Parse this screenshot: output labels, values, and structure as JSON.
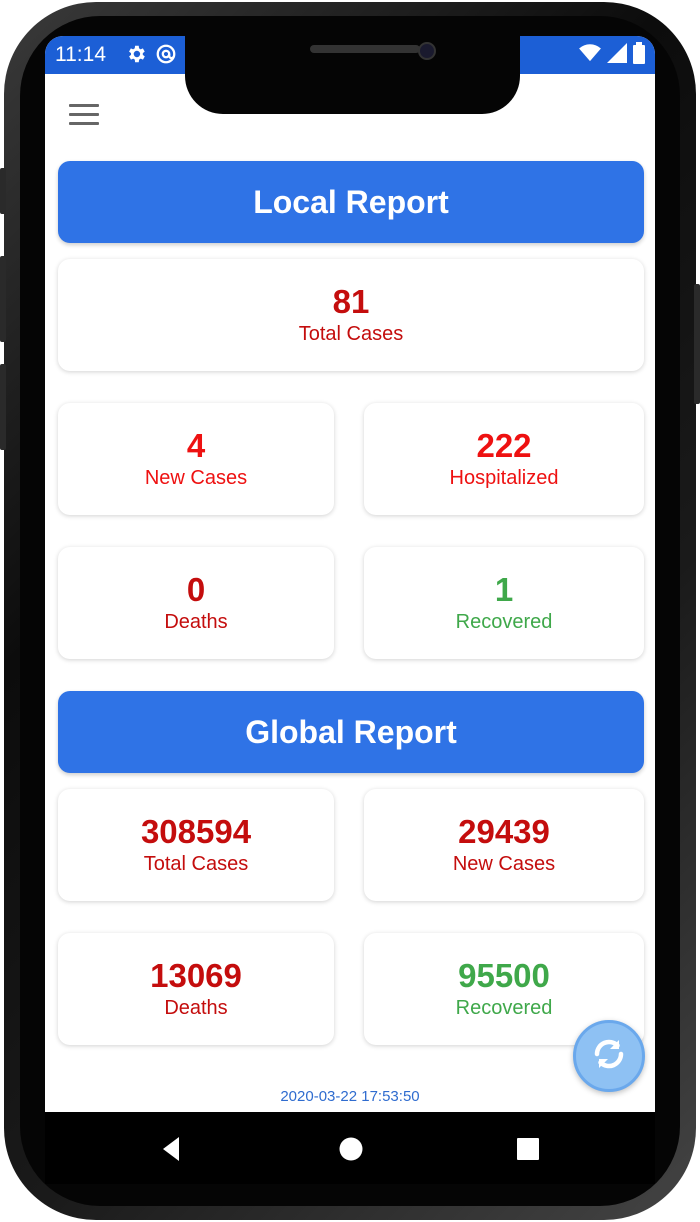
{
  "status_bar": {
    "time": "11:14"
  },
  "local_report": {
    "title": "Local Report",
    "total_cases": {
      "value": "81",
      "label": "Total Cases"
    },
    "new_cases": {
      "value": "4",
      "label": "New Cases"
    },
    "hospitalized": {
      "value": "222",
      "label": "Hospitalized"
    },
    "deaths": {
      "value": "0",
      "label": "Deaths"
    },
    "recovered": {
      "value": "1",
      "label": "Recovered"
    }
  },
  "global_report": {
    "title": "Global Report",
    "total_cases": {
      "value": "308594",
      "label": "Total Cases"
    },
    "new_cases": {
      "value": "29439",
      "label": "New Cases"
    },
    "deaths": {
      "value": "13069",
      "label": "Deaths"
    },
    "recovered": {
      "value": "95500",
      "label": "Recovered"
    }
  },
  "timestamp": "2020-03-22 17:53:50",
  "icons": [
    "gear-icon",
    "at-icon",
    "wifi-icon",
    "signal-icon",
    "battery-icon",
    "menu-icon",
    "refresh-icon",
    "back-icon",
    "home-icon",
    "recents-icon"
  ],
  "colors": {
    "accent": "#2f73e6",
    "status_bar": "#1c5fd6",
    "red": "#c40d0d",
    "bright_red": "#ee1111",
    "green": "#3fa84a",
    "timestamp": "#2f6ccf"
  }
}
